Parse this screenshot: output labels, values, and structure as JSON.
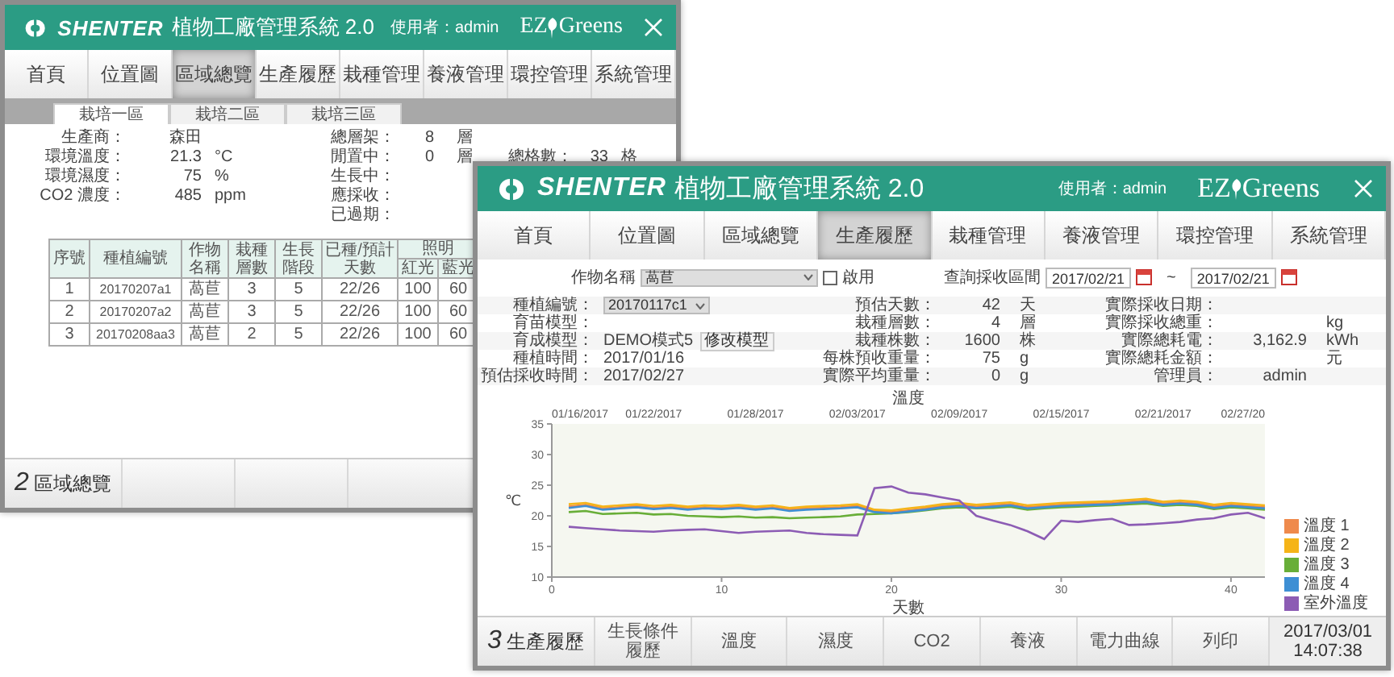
{
  "back_window": {
    "logo": "SHENTER",
    "title": "植物工廠管理系統 2.0",
    "user": "使用者：admin",
    "brand_left": "EZ",
    "brand_right": "Greens",
    "nav": [
      {
        "label": "首頁",
        "selected": false
      },
      {
        "label": "位置圖",
        "selected": false
      },
      {
        "label": "區域總覽",
        "selected": true
      },
      {
        "label": "生產履歷",
        "selected": false
      },
      {
        "label": "栽種管理",
        "selected": false
      },
      {
        "label": "養液管理",
        "selected": false
      },
      {
        "label": "環控管理",
        "selected": false
      },
      {
        "label": "系統管理",
        "selected": false
      }
    ],
    "zone_tabs": [
      {
        "label": "栽培一區",
        "selected": true
      },
      {
        "label": "栽培二區",
        "selected": false
      },
      {
        "label": "栽培三區",
        "selected": false
      }
    ],
    "info_rows": [
      [
        {
          "label": "生產商：",
          "value": "森田"
        },
        {
          "label": "總層架：",
          "value": "8",
          "unit": "層"
        },
        {}
      ],
      [
        {
          "label": "環境溫度：",
          "value": "21.3",
          "unit": "°C"
        },
        {
          "label": "閒置中：",
          "value": "0",
          "unit": "層"
        },
        {
          "label": "總格數：",
          "value": "33",
          "unit": "格"
        }
      ],
      [
        {
          "label": "環境濕度：",
          "value": "75",
          "unit": "%"
        },
        {
          "label": "生長中："
        },
        {}
      ],
      [
        {
          "label": "CO2 濃度：",
          "value": "485",
          "unit": "ppm"
        },
        {
          "label": "應採收："
        },
        {}
      ],
      [
        {},
        {
          "label": "已過期："
        },
        {}
      ]
    ],
    "table": {
      "columns": [
        "序號",
        "種植編號",
        "作物名稱",
        "栽種層數",
        "生長階段",
        "已種/預計天數"
      ],
      "group_column": {
        "label": "照明",
        "subcolumns": [
          "紅光",
          "藍光"
        ]
      },
      "rows": [
        [
          "1",
          "20170207a1",
          "萵苣",
          "3",
          "5",
          "22/26",
          "100",
          "60"
        ],
        [
          "2",
          "20170207a2",
          "萵苣",
          "3",
          "5",
          "22/26",
          "100",
          "60"
        ],
        [
          "3",
          "20170208aa3",
          "萵苣",
          "2",
          "5",
          "22/26",
          "100",
          "60"
        ]
      ]
    },
    "footer": {
      "page_number": "2",
      "page_title": "區域總覽"
    }
  },
  "front_window": {
    "logo": "SHENTER",
    "title": "植物工廠管理系統 2.0",
    "user": "使用者：admin",
    "brand_left": "EZ",
    "brand_right": "Greens",
    "nav": [
      {
        "label": "首頁",
        "selected": false
      },
      {
        "label": "位置圖",
        "selected": false
      },
      {
        "label": "區域總覽",
        "selected": false
      },
      {
        "label": "生產履歷",
        "selected": true
      },
      {
        "label": "栽種管理",
        "selected": false
      },
      {
        "label": "養液管理",
        "selected": false
      },
      {
        "label": "環控管理",
        "selected": false
      },
      {
        "label": "系統管理",
        "selected": false
      }
    ],
    "filter": {
      "crop_label": "作物名稱",
      "crop_value": "萵苣",
      "enable_label": "啟用",
      "enable_checked": false,
      "range_label": "查詢採收區間",
      "date_from": "2017/02/21",
      "separator": "~",
      "date_to": "2017/02/21"
    },
    "details": [
      [
        {
          "kind": "select",
          "label": "種植編號：",
          "value": "20170117c1"
        },
        {
          "kind": "text",
          "label": "預估天數：",
          "value": "42",
          "unit": "天"
        },
        {
          "kind": "text",
          "label": "實際採收日期："
        }
      ],
      [
        {
          "kind": "text",
          "label": "育苗模型："
        },
        {
          "kind": "text",
          "label": "栽種層數：",
          "value": "4",
          "unit": "層"
        },
        {
          "kind": "text",
          "label": "實際採收總重：",
          "unit": "kg"
        }
      ],
      [
        {
          "kind": "text",
          "label": "育成模型：",
          "value": "DEMO模式5",
          "button": "修改模型"
        },
        {
          "kind": "text",
          "label": "栽種株數：",
          "value": "1600",
          "unit": "株"
        },
        {
          "kind": "text",
          "label": "實際總耗電：",
          "value": "3,162.9",
          "unit": "kWh"
        }
      ],
      [
        {
          "kind": "text",
          "label": "種植時間：",
          "value": "2017/01/16"
        },
        {
          "kind": "text",
          "label": "每株預收重量：",
          "value": "75",
          "unit": "g"
        },
        {
          "kind": "text",
          "label": "實際總耗金額：",
          "unit": "元"
        }
      ],
      [
        {
          "kind": "text",
          "label": "預估採收時間：",
          "value": "2017/02/27"
        },
        {
          "kind": "text",
          "label": "實際平均重量：",
          "value": "0",
          "unit": "g"
        },
        {
          "kind": "text",
          "label": "管理員：",
          "value": "admin"
        }
      ]
    ],
    "chart": {
      "top_axis_labels": [
        "01/16/2017",
        "01/22/2017",
        "01/28/2017",
        "02/03/2017",
        "02/09/2017",
        "02/15/2017",
        "02/21/2017",
        "02/27/20"
      ],
      "chart_data": {
        "type": "line",
        "legend": "right",
        "title": "溫度",
        "xlabel": "天數",
        "ylabel": "℃",
        "xlim": [
          0,
          42
        ],
        "ylim": [
          10,
          35
        ],
        "xticks": [
          0,
          10,
          20,
          30,
          40
        ],
        "yticks": [
          10,
          15,
          20,
          25,
          30,
          35
        ],
        "x": [
          1,
          2,
          3,
          4,
          5,
          6,
          7,
          8,
          9,
          10,
          11,
          12,
          13,
          14,
          15,
          16,
          17,
          18,
          19,
          20,
          21,
          22,
          23,
          24,
          25,
          26,
          27,
          28,
          29,
          30,
          31,
          32,
          33,
          34,
          35,
          36,
          37,
          38,
          39,
          40,
          41,
          42
        ],
        "series": [
          {
            "name": "溫度 1",
            "color": "#ef8a4c",
            "values": [
              21.5,
              21.8,
              21.2,
              21.4,
              21.6,
              21.3,
              21.5,
              21.2,
              21.4,
              21.3,
              21.5,
              21.2,
              21.4,
              21.0,
              21.2,
              21.3,
              21.4,
              21.6,
              20.8,
              20.6,
              20.9,
              21.2,
              21.6,
              21.8,
              21.5,
              21.7,
              21.9,
              21.4,
              21.6,
              21.8,
              21.9,
              22.0,
              22.1,
              22.3,
              22.5,
              22.0,
              22.2,
              22.0,
              21.5,
              21.8,
              21.6,
              21.4
            ]
          },
          {
            "name": "溫度 2",
            "color": "#f5b418",
            "values": [
              21.9,
              22.1,
              21.5,
              21.7,
              21.9,
              21.6,
              21.8,
              21.5,
              21.7,
              21.6,
              21.8,
              21.5,
              21.7,
              21.3,
              21.5,
              21.6,
              21.7,
              21.9,
              21.0,
              20.9,
              21.2,
              21.5,
              21.9,
              22.1,
              21.8,
              22.0,
              22.2,
              21.7,
              21.9,
              22.1,
              22.2,
              22.3,
              22.4,
              22.6,
              22.8,
              22.3,
              22.5,
              22.3,
              21.8,
              22.1,
              21.9,
              21.7
            ]
          },
          {
            "name": "溫度 3",
            "color": "#68ae38",
            "values": [
              20.6,
              20.8,
              20.3,
              20.4,
              20.5,
              20.2,
              20.3,
              20.0,
              19.9,
              19.8,
              19.9,
              19.7,
              19.8,
              19.6,
              19.7,
              19.8,
              19.9,
              20.2,
              20.3,
              20.4,
              20.6,
              20.9,
              21.2,
              21.4,
              21.2,
              21.3,
              21.5,
              21.0,
              21.2,
              21.4,
              21.5,
              21.6,
              21.7,
              21.9,
              22.0,
              21.6,
              21.8,
              21.6,
              21.1,
              21.4,
              21.2,
              21.0
            ]
          },
          {
            "name": "溫度 4",
            "color": "#3e8fd4",
            "values": [
              21.3,
              21.6,
              21.0,
              21.2,
              21.4,
              21.1,
              21.3,
              21.0,
              21.2,
              21.1,
              21.3,
              21.0,
              21.2,
              20.8,
              21.0,
              21.1,
              21.2,
              21.4,
              20.6,
              20.4,
              20.7,
              21.0,
              21.4,
              21.6,
              21.3,
              21.5,
              21.7,
              21.2,
              21.4,
              21.6,
              21.7,
              21.8,
              21.9,
              22.1,
              22.3,
              21.8,
              22.0,
              21.8,
              21.3,
              21.6,
              21.4,
              21.2
            ]
          },
          {
            "name": "室外溫度",
            "color": "#8c5cb4",
            "values": [
              18.2,
              18.0,
              17.8,
              17.6,
              17.5,
              17.4,
              17.6,
              17.7,
              17.8,
              17.5,
              17.2,
              17.4,
              17.5,
              17.6,
              17.2,
              17.0,
              16.9,
              16.8,
              24.5,
              24.8,
              23.8,
              23.5,
              23.0,
              22.5,
              20.0,
              19.2,
              18.5,
              17.5,
              16.2,
              19.2,
              19.0,
              19.3,
              19.5,
              18.5,
              18.6,
              18.8,
              19.0,
              19.4,
              19.6,
              20.2,
              20.5,
              19.6
            ]
          }
        ]
      }
    },
    "footer": {
      "page_number": "3",
      "page_title": "生產履歷",
      "buttons": [
        "生長條件履歷",
        "溫度",
        "濕度",
        "CO2",
        "養液",
        "電力曲線",
        "列印"
      ],
      "clock_date": "2017/03/01",
      "clock_time": "14:07:38"
    }
  }
}
